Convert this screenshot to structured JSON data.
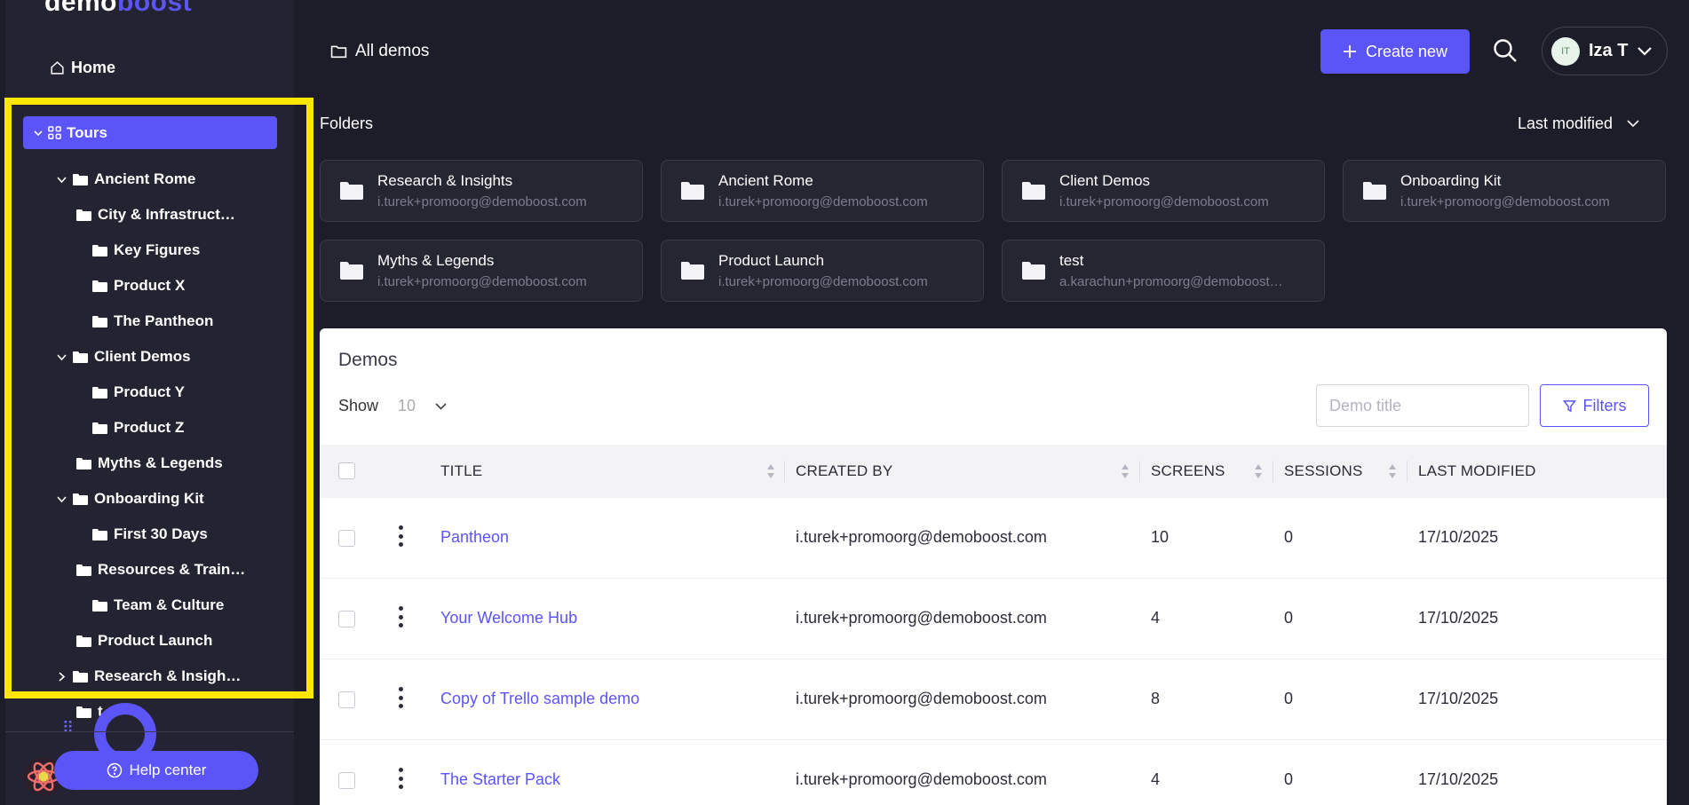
{
  "brand": {
    "part1": "demo",
    "part2": "boost"
  },
  "nav": {
    "home_label": "Home"
  },
  "tree": {
    "root_label": "Tours",
    "items": [
      {
        "label": "Ancient Rome",
        "chevron": "down"
      },
      {
        "label": "City & Infrastruct…",
        "chevron": ""
      },
      {
        "label": "Key Figures",
        "chevron": ""
      },
      {
        "label": "Product X",
        "chevron": ""
      },
      {
        "label": "The Pantheon",
        "chevron": ""
      },
      {
        "label": "Client Demos",
        "chevron": "down"
      },
      {
        "label": "Product Y",
        "chevron": ""
      },
      {
        "label": "Product Z",
        "chevron": ""
      },
      {
        "label": "Myths & Legends",
        "chevron": ""
      },
      {
        "label": "Onboarding Kit",
        "chevron": "down"
      },
      {
        "label": "First 30 Days",
        "chevron": ""
      },
      {
        "label": "Resources & Train…",
        "chevron": ""
      },
      {
        "label": "Team & Culture",
        "chevron": ""
      },
      {
        "label": "Product Launch",
        "chevron": ""
      },
      {
        "label": "Research & Insigh…",
        "chevron": "right"
      },
      {
        "label": "t…",
        "chevron": ""
      }
    ]
  },
  "help": {
    "label": "Help center"
  },
  "header": {
    "breadcrumb": "All demos",
    "create_label": "Create new",
    "user_initials": "IT",
    "user_name": "Iza T"
  },
  "folders": {
    "title": "Folders",
    "sort_label": "Last modified",
    "cards": [
      {
        "name": "Research & Insights",
        "owner": "i.turek+promoorg@demoboost.com"
      },
      {
        "name": "Ancient Rome",
        "owner": "i.turek+promoorg@demoboost.com"
      },
      {
        "name": "Client Demos",
        "owner": "i.turek+promoorg@demoboost.com"
      },
      {
        "name": "Onboarding Kit",
        "owner": "i.turek+promoorg@demoboost.com"
      },
      {
        "name": "Myths & Legends",
        "owner": "i.turek+promoorg@demoboost.com"
      },
      {
        "name": "Product Launch",
        "owner": "i.turek+promoorg@demoboost.com"
      },
      {
        "name": "test",
        "owner": "a.karachun+promoorg@demoboost.com"
      }
    ]
  },
  "demos": {
    "title": "Demos",
    "show_label": "Show",
    "page_size": "10",
    "search_placeholder": "Demo title",
    "filters_label": "Filters",
    "columns": [
      "TITLE",
      "CREATED BY",
      "SCREENS",
      "SESSIONS",
      "LAST MODIFIED"
    ],
    "rows": [
      {
        "title": "Pantheon",
        "created_by": "i.turek+promoorg@demoboost.com",
        "screens": "10",
        "sessions": "0",
        "modified": "17/10/2025"
      },
      {
        "title": "Your Welcome Hub",
        "created_by": "i.turek+promoorg@demoboost.com",
        "screens": "4",
        "sessions": "0",
        "modified": "17/10/2025"
      },
      {
        "title": "Copy of Trello sample demo",
        "created_by": "i.turek+promoorg@demoboost.com",
        "screens": "8",
        "sessions": "0",
        "modified": "17/10/2025"
      },
      {
        "title": "The Starter Pack",
        "created_by": "i.turek+promoorg@demoboost.com",
        "screens": "4",
        "sessions": "0",
        "modified": "17/10/2025"
      }
    ]
  },
  "colors": {
    "accent": "#5b54f6",
    "highlight": "#ffe600",
    "sidebar_bg": "#232331",
    "page_bg": "#1d1d29"
  }
}
